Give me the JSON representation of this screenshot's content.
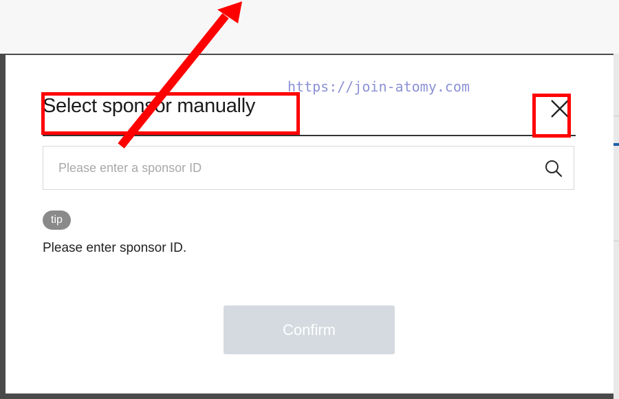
{
  "modal": {
    "title": "Select sponsor manually",
    "close_icon": "close-icon",
    "search": {
      "placeholder": "Please enter a sponsor ID",
      "value": "",
      "search_icon": "search-icon"
    },
    "tip": {
      "badge": "tip",
      "text": "Please enter sponsor ID."
    },
    "confirm_label": "Confirm"
  },
  "watermark": "https://join-atomy.com",
  "annotations": {
    "highlight_color": "#ff0000",
    "arrow_icon": "arrow-up-right-icon"
  },
  "colors": {
    "confirm_disabled_bg": "#d4dadf",
    "tip_badge_bg": "#8a8a8a",
    "watermark": "#7f86d2"
  }
}
